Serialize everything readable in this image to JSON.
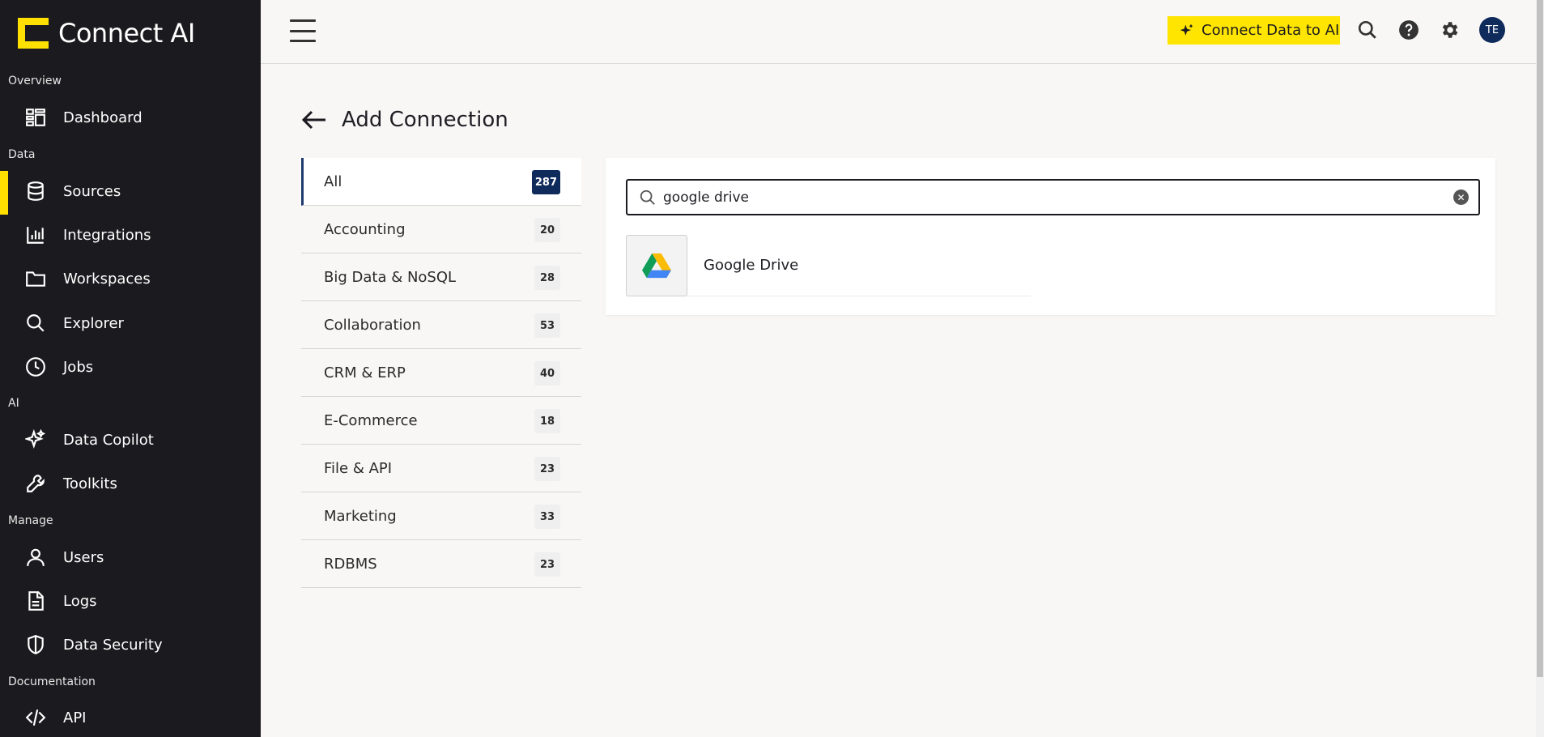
{
  "sidebar": {
    "logo": "Connect AI",
    "sections": [
      {
        "label": "Overview"
      },
      {
        "label": "Data"
      },
      {
        "label": "AI"
      },
      {
        "label": "Manage"
      },
      {
        "label": "Documentation"
      }
    ],
    "items": [
      {
        "label": "Dashboard",
        "icon": "dashboard-icon"
      },
      {
        "label": "Sources",
        "icon": "database-icon",
        "active": true
      },
      {
        "label": "Integrations",
        "icon": "bar-chart-icon"
      },
      {
        "label": "Workspaces",
        "icon": "folder-icon"
      },
      {
        "label": "Explorer",
        "icon": "search-icon"
      },
      {
        "label": "Jobs",
        "icon": "clock-icon"
      },
      {
        "label": "Data Copilot",
        "icon": "sparkle-icon"
      },
      {
        "label": "Toolkits",
        "icon": "wrench-icon"
      },
      {
        "label": "Users",
        "icon": "user-icon"
      },
      {
        "label": "Logs",
        "icon": "document-icon"
      },
      {
        "label": "Data Security",
        "icon": "shield-icon"
      },
      {
        "label": "API",
        "icon": "code-icon"
      }
    ]
  },
  "topbar": {
    "connect_label": "Connect Data to AI",
    "avatar_initials": "TE"
  },
  "page": {
    "title": "Add Connection"
  },
  "categories": [
    {
      "label": "All",
      "count": "287",
      "active": true
    },
    {
      "label": "Accounting",
      "count": "20"
    },
    {
      "label": "Big Data & NoSQL",
      "count": "28"
    },
    {
      "label": "Collaboration",
      "count": "53"
    },
    {
      "label": "CRM & ERP",
      "count": "40"
    },
    {
      "label": "E-Commerce",
      "count": "18"
    },
    {
      "label": "File & API",
      "count": "23"
    },
    {
      "label": "Marketing",
      "count": "33"
    },
    {
      "label": "RDBMS",
      "count": "23"
    }
  ],
  "search": {
    "value": "google drive"
  },
  "results": [
    {
      "name": "Google Drive",
      "icon": "google-drive-icon"
    }
  ],
  "colors": {
    "accent": "#ffe000",
    "sidebar_bg": "#1b1b1f",
    "badge_active": "#0f2b5c"
  }
}
